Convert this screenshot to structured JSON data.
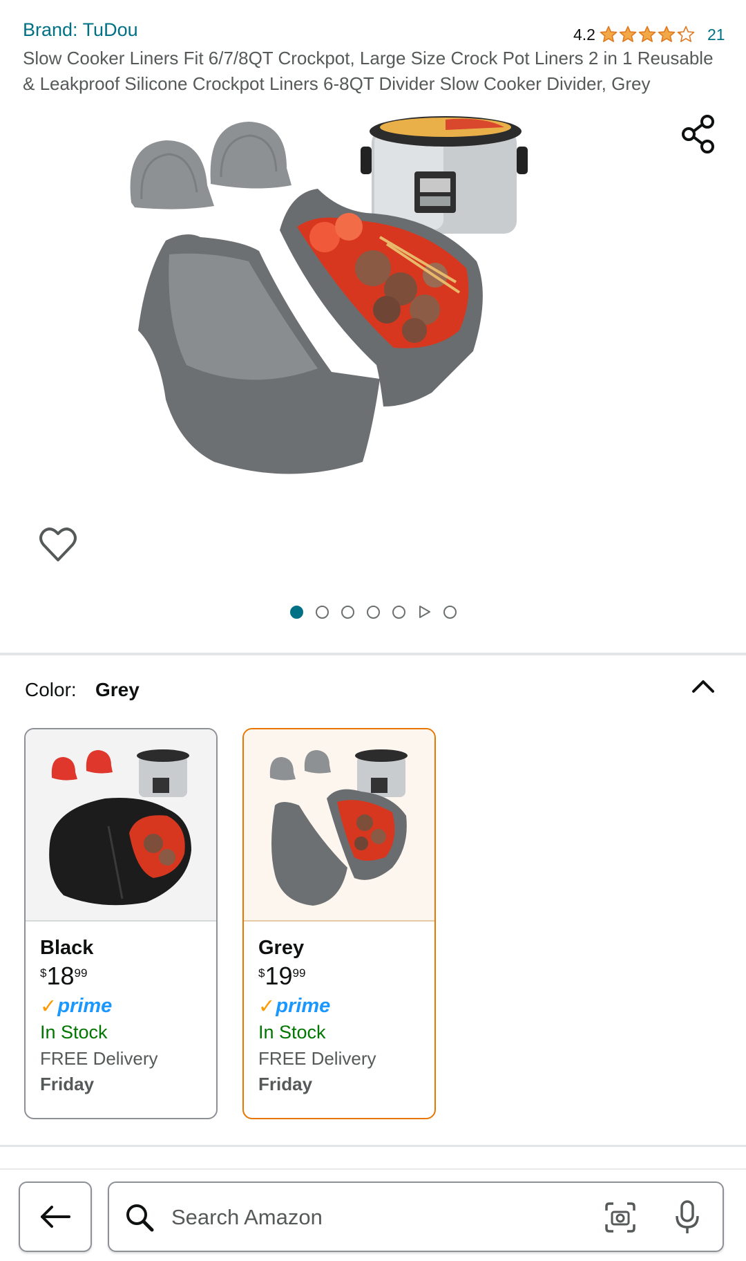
{
  "header": {
    "brand": "Brand: TuDou",
    "rating_value": "4.2",
    "rating_stars": 4.2,
    "rating_count": "21",
    "title": "Slow Cooker Liners Fit 6/7/8QT Crockpot, Large Size Crock Pot Liners 2 in 1 Reusable & Leakproof Silicone Crockpot Liners 6-8QT Divider Slow Cooker Divider, Grey"
  },
  "gallery": {
    "current_index": 1,
    "total_items": 7,
    "video_index": 6,
    "hero_icon": "product-image",
    "share_icon": "share-icon",
    "wishlist_icon": "heart-icon"
  },
  "variations": {
    "label": "Color:",
    "selected": "Grey",
    "options": [
      {
        "name": "Black",
        "currency": "$",
        "whole": "18",
        "fraction": "99",
        "prime": "prime",
        "stock": "In Stock",
        "delivery": "FREE Delivery",
        "day": "Friday"
      },
      {
        "name": "Grey",
        "currency": "$",
        "whole": "19",
        "fraction": "99",
        "prime": "prime",
        "stock": "In Stock",
        "delivery": "FREE Delivery",
        "day": "Friday"
      }
    ]
  },
  "bottom_bar": {
    "search_placeholder": "Search Amazon"
  },
  "colors": {
    "link": "#007185",
    "prime": "#1a98ff",
    "prime_check": "#ff9900",
    "in_stock": "#007600",
    "selected_border": "#e77600",
    "star": "#f3a847"
  }
}
